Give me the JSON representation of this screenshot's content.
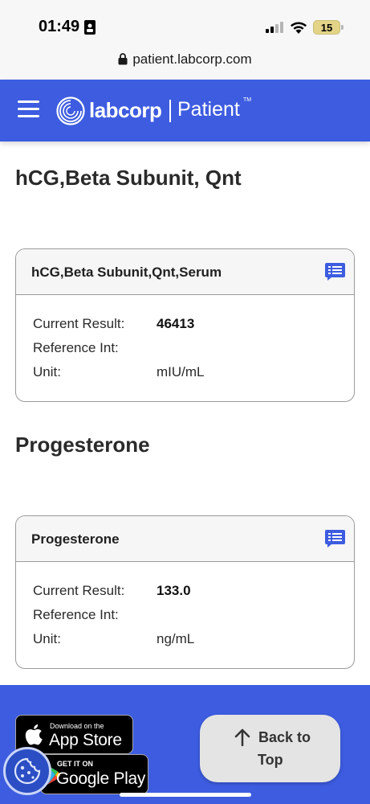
{
  "status_bar": {
    "time": "01:49",
    "battery": "15"
  },
  "url_bar": {
    "url": "patient.labcorp.com"
  },
  "header": {
    "brand": "labcorp",
    "product": "Patient",
    "trademark": "TM"
  },
  "tests": [
    {
      "section_title": "hCG,Beta Subunit, Qnt",
      "card_title": "hCG,Beta Subunit,Qnt,Serum",
      "current_result_label": "Current Result:",
      "current_result": "46413",
      "reference_label": "Reference Int:",
      "reference": "",
      "unit_label": "Unit:",
      "unit": "mIU/mL"
    },
    {
      "section_title": "Progesterone",
      "card_title": "Progesterone",
      "current_result_label": "Current Result:",
      "current_result": "133.0",
      "reference_label": "Reference Int:",
      "reference": "",
      "unit_label": "Unit:",
      "unit": "ng/mL"
    }
  ],
  "footer": {
    "app_store_small": "Download on the",
    "app_store_large": "App Store",
    "play_store_small": "GET IT ON",
    "play_store_large": "Google Play",
    "back_to_top_line1": "Back to",
    "back_to_top_line2": "Top"
  },
  "colors": {
    "brand_blue": "#3d5ce0",
    "card_border": "#9b9b9b",
    "icon_blue": "#3d5ce0"
  },
  "icons": {
    "lock": "lock-icon",
    "menu": "hamburger-menu-icon",
    "details": "list-details-icon",
    "arrow_up": "arrow-up-icon",
    "cookie": "cookie-icon"
  }
}
